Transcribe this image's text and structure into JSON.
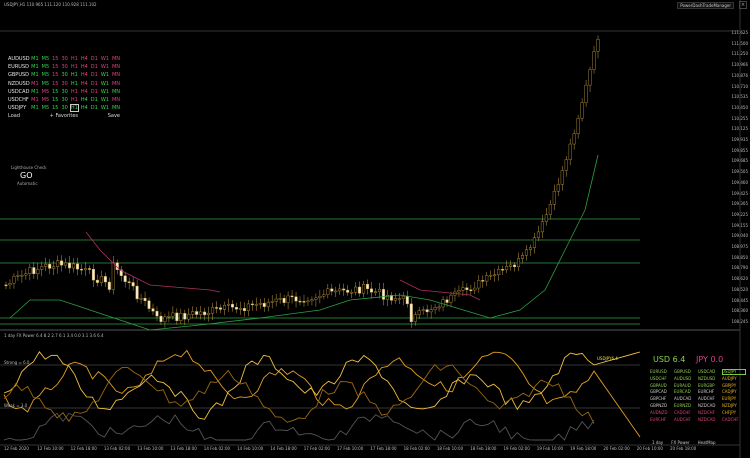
{
  "chart": {
    "info": "USDJPY,H1  110.965 111.120 110.928 111.102",
    "trade_manager": "PowerDashTradeManager",
    "close_icon": "x-icon",
    "price_ticks": [
      "111.625",
      "111.500",
      "111.250",
      "110.966",
      "110.876",
      "110.710",
      "110.535",
      "110.450",
      "110.255",
      "110.125",
      "109.935",
      "109.855",
      "109.685",
      "109.505",
      "109.460",
      "109.425",
      "109.305",
      "109.225",
      "109.155",
      "109.040",
      "108.975",
      "108.850",
      "108.790",
      "108.620",
      "108.520",
      "108.445",
      "108.360",
      "108.245"
    ],
    "times": [
      "12 Feb 2020",
      "12 Feb 10:00",
      "12 Feb 18:00",
      "13 Feb 02:00",
      "13 Feb 10:00",
      "13 Feb 18:00",
      "14 Feb 02:00",
      "14 Feb 10:00",
      "14 Feb 18:00",
      "17 Feb 02:00",
      "17 Feb 10:00",
      "17 Feb 18:00",
      "18 Feb 02:00",
      "18 Feb 10:00",
      "18 Feb 18:00",
      "19 Feb 02:00",
      "19 Feb 10:00",
      "19 Feb 18:00",
      "20 Feb 02:00",
      "20 Feb 10:00",
      "20 Feb 18:00"
    ]
  },
  "symbols": [
    {
      "name": "AUDUSD",
      "tfs": [
        {
          "l": "M1",
          "c": "#39d353"
        },
        {
          "l": "M5",
          "c": "#39d353"
        },
        {
          "l": "15",
          "c": "#e04080"
        },
        {
          "l": "30",
          "c": "#e04080"
        },
        {
          "l": "H1",
          "c": "#e04080"
        },
        {
          "l": "H4",
          "c": "#e04080"
        },
        {
          "l": "D1",
          "c": "#e04080"
        },
        {
          "l": "W1",
          "c": "#e04080"
        },
        {
          "l": "MN",
          "c": "#e04080"
        }
      ]
    },
    {
      "name": "EURUSD",
      "tfs": [
        {
          "l": "M1",
          "c": "#39d353"
        },
        {
          "l": "M5",
          "c": "#39d353"
        },
        {
          "l": "15",
          "c": "#e04080"
        },
        {
          "l": "30",
          "c": "#e04080"
        },
        {
          "l": "H1",
          "c": "#e04080"
        },
        {
          "l": "H4",
          "c": "#e04080"
        },
        {
          "l": "D1",
          "c": "#e04080"
        },
        {
          "l": "W1",
          "c": "#e04080"
        },
        {
          "l": "MN",
          "c": "#e04080"
        }
      ]
    },
    {
      "name": "GBPUSD",
      "tfs": [
        {
          "l": "M1",
          "c": "#39d353"
        },
        {
          "l": "M5",
          "c": "#39d353"
        },
        {
          "l": "15",
          "c": "#e04080"
        },
        {
          "l": "30",
          "c": "#39d353"
        },
        {
          "l": "H1",
          "c": "#39d353"
        },
        {
          "l": "H4",
          "c": "#e04080"
        },
        {
          "l": "D1",
          "c": "#e04080"
        },
        {
          "l": "W1",
          "c": "#39d353"
        },
        {
          "l": "MN",
          "c": "#e04080"
        }
      ]
    },
    {
      "name": "NZDUSD",
      "tfs": [
        {
          "l": "M1",
          "c": "#e04080"
        },
        {
          "l": "M5",
          "c": "#39d353"
        },
        {
          "l": "15",
          "c": "#e04080"
        },
        {
          "l": "30",
          "c": "#e04080"
        },
        {
          "l": "H1",
          "c": "#39d353"
        },
        {
          "l": "H4",
          "c": "#e04080"
        },
        {
          "l": "D1",
          "c": "#e04080"
        },
        {
          "l": "W1",
          "c": "#39d353"
        },
        {
          "l": "MN",
          "c": "#e04080"
        }
      ]
    },
    {
      "name": "USDCAD",
      "tfs": [
        {
          "l": "M1",
          "c": "#39d353"
        },
        {
          "l": "M5",
          "c": "#e04080"
        },
        {
          "l": "15",
          "c": "#39d353"
        },
        {
          "l": "30",
          "c": "#39d353"
        },
        {
          "l": "H1",
          "c": "#e04080"
        },
        {
          "l": "H4",
          "c": "#e04080"
        },
        {
          "l": "D1",
          "c": "#e04080"
        },
        {
          "l": "W1",
          "c": "#39d353"
        },
        {
          "l": "MN",
          "c": "#39d353"
        }
      ]
    },
    {
      "name": "USDCHF",
      "tfs": [
        {
          "l": "M1",
          "c": "#e04080"
        },
        {
          "l": "M5",
          "c": "#e04080"
        },
        {
          "l": "15",
          "c": "#39d353"
        },
        {
          "l": "30",
          "c": "#39d353"
        },
        {
          "l": "H1",
          "c": "#e04080"
        },
        {
          "l": "H4",
          "c": "#39d353"
        },
        {
          "l": "D1",
          "c": "#39d353"
        },
        {
          "l": "W1",
          "c": "#39d353"
        },
        {
          "l": "MN",
          "c": "#e04080"
        }
      ]
    },
    {
      "name": "USDJPY",
      "tfs": [
        {
          "l": "M1",
          "c": "#39d353"
        },
        {
          "l": "M5",
          "c": "#39d353"
        },
        {
          "l": "15",
          "c": "#39d353"
        },
        {
          "l": "30",
          "c": "#39d353"
        },
        {
          "l": "H1",
          "c": "#39d353"
        },
        {
          "l": "H4",
          "c": "#39d353"
        },
        {
          "l": "D1",
          "c": "#39d353"
        },
        {
          "l": "W1",
          "c": "#39d353"
        },
        {
          "l": "MN",
          "c": "#39d353"
        }
      ]
    }
  ],
  "panel": {
    "load": "Load",
    "favorites": "Favorites",
    "save": "Save",
    "fav_icon": "plus-icon"
  },
  "lighthouse": {
    "title": "Lighthouse Check",
    "status": "GO",
    "mode": "Automatic"
  },
  "subwindow": {
    "title": "1 day  FX Power  6.4  8.2  2.7  6.1  3.4  0.0  3.1  3.6  6.4",
    "strong": "Strong = 6.0",
    "weak": "Weak = 3.0"
  },
  "meter": {
    "usd": "USD 6.4",
    "jpy": "JPY 0.0",
    "line_label": "USDJPY6.4",
    "pairs": [
      {
        "t": "EURUSD",
        "c": "#8fd14f"
      },
      {
        "t": "GBPUSD",
        "c": "#8fd14f"
      },
      {
        "t": "USDCAD",
        "c": "#8fd14f"
      },
      {
        "t": "USDJPY",
        "c": "#8fd14f",
        "hl": true
      },
      {
        "t": "USDCHF",
        "c": "#8fd14f"
      },
      {
        "t": "AUDUSD",
        "c": "#8fd14f"
      },
      {
        "t": "NZDUSD",
        "c": "#8fd14f"
      },
      {
        "t": "AUDJPY",
        "c": "#e6b422"
      },
      {
        "t": "GBPAUD",
        "c": "#8fd14f"
      },
      {
        "t": "EURAUD",
        "c": "#8fd14f"
      },
      {
        "t": "EURGBP",
        "c": "#8fd14f"
      },
      {
        "t": "GBPJPY",
        "c": "#e6b422"
      },
      {
        "t": "GBPCAD",
        "c": "#cccccc"
      },
      {
        "t": "EURCAD",
        "c": "#8fd14f"
      },
      {
        "t": "EURCHF",
        "c": "#cccccc"
      },
      {
        "t": "CADJPY",
        "c": "#e6b422"
      },
      {
        "t": "GBPCHF",
        "c": "#cccccc"
      },
      {
        "t": "AUDCAD",
        "c": "#cccccc"
      },
      {
        "t": "AUDCHF",
        "c": "#cccccc"
      },
      {
        "t": "EURJPY",
        "c": "#e6b422"
      },
      {
        "t": "GBPNZD",
        "c": "#cccccc"
      },
      {
        "t": "EURNZD",
        "c": "#8fd14f"
      },
      {
        "t": "NZDCAD",
        "c": "#cccccc"
      },
      {
        "t": "NZDJPY",
        "c": "#e6b422"
      },
      {
        "t": "AUDNZD",
        "c": "#e04080"
      },
      {
        "t": "CADCHF",
        "c": "#e04080"
      },
      {
        "t": "NZDCHF",
        "c": "#e04080"
      },
      {
        "t": "CHFJPY",
        "c": "#e6b422"
      },
      {
        "t": "EURCHF",
        "c": "#e04080"
      },
      {
        "t": "AUDCHF",
        "c": "#e04080"
      },
      {
        "t": "NZDCAD",
        "c": "#e04080"
      },
      {
        "t": "CADCHF",
        "c": "#e04080"
      }
    ],
    "ctrl": [
      "1 day",
      "FX Power",
      "HeatMap"
    ]
  }
}
